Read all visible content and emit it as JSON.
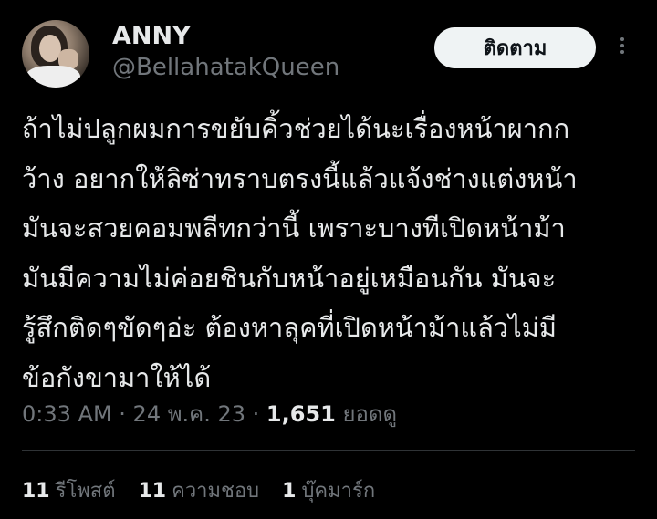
{
  "user": {
    "name": "ANNY",
    "handle": "@BellahatakQueen"
  },
  "follow_button": "ติดตาม",
  "more_icon": "more-options-icon",
  "tweet": {
    "lines": [
      "ถ้าไม่ปลูกผมการขยับคิ้วช่วยได้นะเรื่องหน้าผากก",
      "ว้าง อยากให้ลิซ่าทราบตรงนี้แล้วแจ้งช่างแต่งหน้า",
      "มันจะสวยคอมพลีทกว่านี้ เพราะบางทีเปิดหน้าม้า",
      "มันมีความไม่ค่อยชินกับหน้าอยู่เหมือนกัน มันจะ",
      "รู้สึกติดๆขัดๆอ่ะ ต้องหาลุคที่เปิดหน้าม้าแล้วไม่มี",
      "ข้อกังขามาให้ได้"
    ]
  },
  "meta": {
    "time": "0:33 AM",
    "sep1": " · ",
    "date": "24 พ.ค. 23",
    "sep2": " · ",
    "views_count": "1,651",
    "views_label": " ยอดดู"
  },
  "stats": {
    "retweets": {
      "count": "11",
      "label": "รีโพสต์"
    },
    "likes": {
      "count": "11",
      "label": "ความชอบ"
    },
    "bookmarks": {
      "count": "1",
      "label": "บุ๊คมาร์ก"
    }
  }
}
